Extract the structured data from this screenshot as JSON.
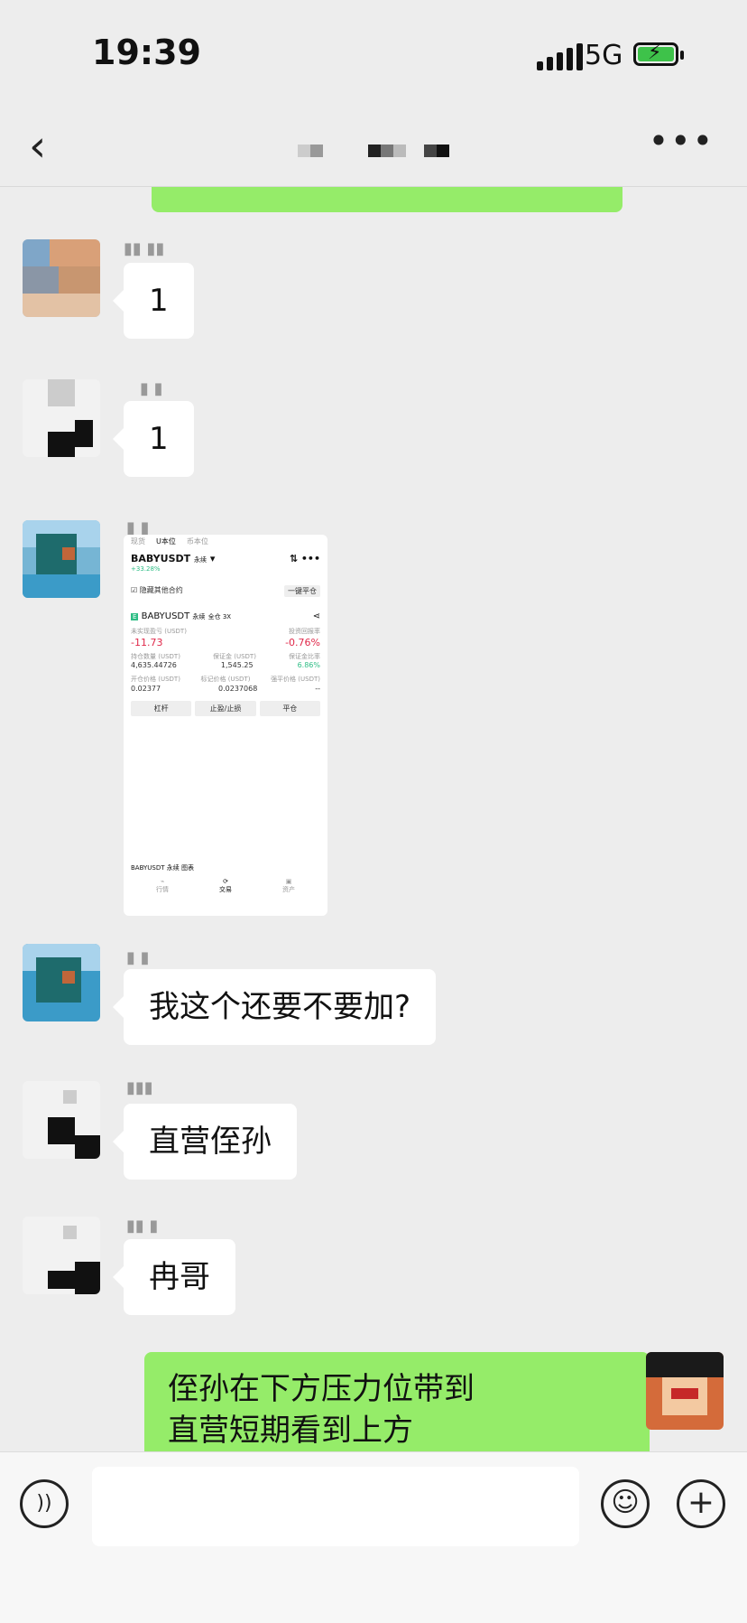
{
  "status": {
    "time": "19:39",
    "network": "5G"
  },
  "nav": {
    "back_icon": "chevron-left-icon",
    "more_icon": "more-icon"
  },
  "messages": [
    {
      "text": "1"
    },
    {
      "text": "1"
    },
    {
      "screenshot": {
        "tabs": [
          "现货",
          "U本位",
          "币本位"
        ],
        "pair": "BABYUSDT",
        "pair_type": "永续",
        "change": "+33.28%",
        "hide_other": "隐藏其他合约",
        "close_all": "一键平仓",
        "position_symbol": "BABYUSDT",
        "position_tag1": "永续",
        "position_tag2": "全仓 3X",
        "unreal_label": "未实现盈亏 (USDT)",
        "roi_label": "投资回报率",
        "unreal_value": "-11.73",
        "roi_value": "-0.76%",
        "size_label": "持仓数量 (USDT)",
        "margin_label": "保证金 (USDT)",
        "margin_ratio_label": "保证金比率",
        "size_value": "4,635.44726",
        "margin_value": "1,545.25",
        "margin_ratio_value": "6.86%",
        "entry_label": "开仓价格 (USDT)",
        "mark_label": "标记价格 (USDT)",
        "liq_label": "强平价格 (USDT)",
        "entry_value": "0.02377",
        "mark_value": "0.0237068",
        "liq_value": "--",
        "btn1": "杠杆",
        "btn2": "止盈/止损",
        "btn3": "平仓",
        "footer_label": "BABYUSDT 永续 图表",
        "nav1": "行情",
        "nav2": "交易",
        "nav3": "资产"
      }
    },
    {
      "text": "我这个还要不要加?"
    },
    {
      "text": "直营侄孙"
    },
    {
      "text": "冉哥"
    },
    {
      "text_line1": "侄孙在下方压力位带到",
      "text_line2": "直营短期看到上方"
    }
  ],
  "input": {
    "voice_icon": "voice-icon",
    "emoji_icon": "emoji-icon",
    "plus_icon": "plus-icon"
  }
}
